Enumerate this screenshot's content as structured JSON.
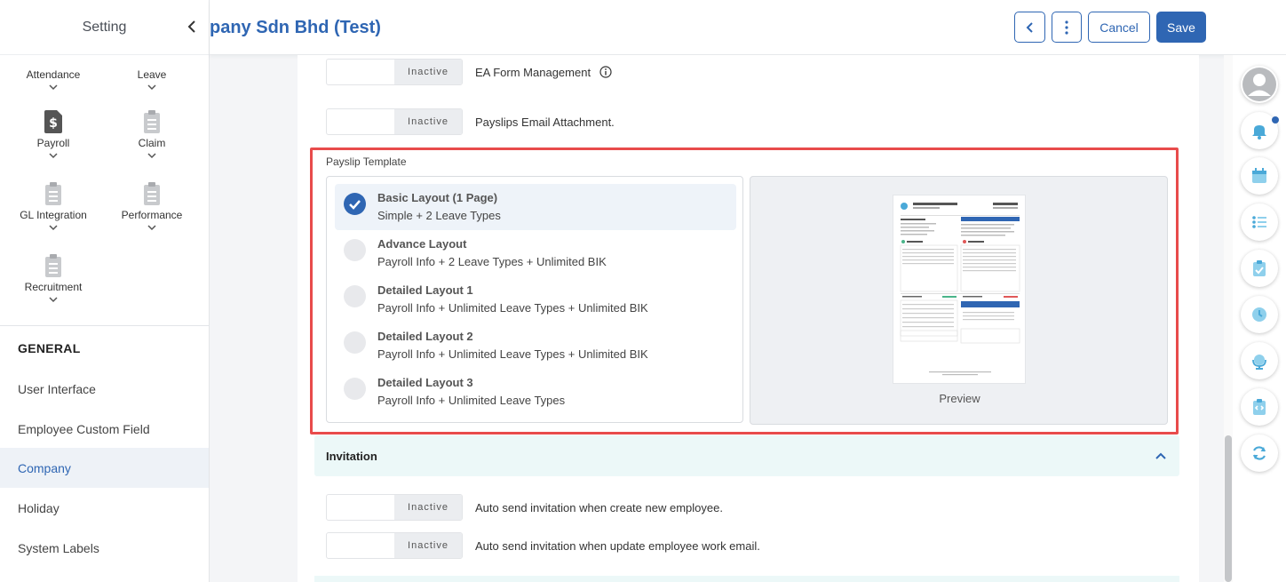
{
  "sidebar": {
    "title": "Setting",
    "modules": [
      {
        "label": "Attendance"
      },
      {
        "label": "Leave"
      },
      {
        "label": "Payroll",
        "icon": "dollar-doc-icon"
      },
      {
        "label": "Claim",
        "icon": "clipboard-icon"
      },
      {
        "label": "GL Integration",
        "icon": "clipboard-icon"
      },
      {
        "label": "Performance",
        "icon": "clipboard-icon"
      },
      {
        "label": "Recruitment",
        "icon": "clipboard-icon"
      }
    ],
    "section_heading": "GENERAL",
    "items": [
      {
        "label": "User Interface"
      },
      {
        "label": "Employee Custom Field"
      },
      {
        "label": "Company"
      },
      {
        "label": "Holiday"
      },
      {
        "label": "System Labels"
      }
    ],
    "active_item": "Company"
  },
  "header": {
    "title": "pany Sdn Bhd (Test)",
    "cancel_label": "Cancel",
    "save_label": "Save"
  },
  "settings": {
    "ea_form": {
      "status": "Inactive",
      "label": "EA Form Management"
    },
    "payslip_email": {
      "status": "Inactive",
      "label": "Payslips Email Attachment."
    }
  },
  "payslip_template": {
    "label": "Payslip Template",
    "options": [
      {
        "title": "Basic Layout (1 Page)",
        "subtitle": "Simple + 2 Leave Types",
        "selected": true
      },
      {
        "title": "Advance Layout",
        "subtitle": "Payroll Info + 2 Leave Types + Unlimited BIK",
        "selected": false
      },
      {
        "title": "Detailed Layout 1",
        "subtitle": "Payroll Info + Unlimited Leave Types + Unlimited BIK",
        "selected": false
      },
      {
        "title": "Detailed Layout 2",
        "subtitle": "Payroll Info + Unlimited Leave Types + Unlimited BIK",
        "selected": false
      },
      {
        "title": "Detailed Layout 3",
        "subtitle": "Payroll Info + Unlimited Leave Types",
        "selected": false
      }
    ],
    "preview_label": "Preview"
  },
  "invitation": {
    "title": "Invitation",
    "rows": [
      {
        "status": "Inactive",
        "label": "Auto send invitation when create new employee."
      },
      {
        "status": "Inactive",
        "label": "Auto send invitation when update employee work email."
      }
    ]
  },
  "dock": {
    "items": [
      "avatar",
      "bell-icon",
      "calendar-icon",
      "list-icon",
      "checklist-icon",
      "clock-icon",
      "globe-icon",
      "code-clipboard-icon",
      "refresh-icon"
    ]
  },
  "colors": {
    "brand": "#2f66b3",
    "highlight": "#e84b4b",
    "section_bg": "#ecf8f8"
  }
}
